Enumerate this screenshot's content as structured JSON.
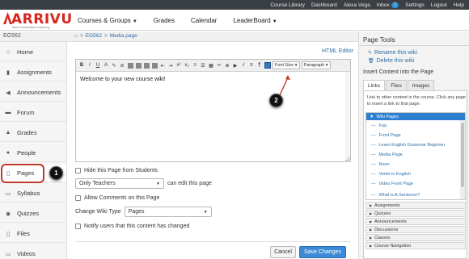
{
  "topbar": {
    "links": [
      "Course Library",
      "Dashboard",
      "Alexa Vega",
      "Inbox",
      "Settings",
      "Logout",
      "Help"
    ],
    "inbox_count": "7"
  },
  "logo": {
    "name": "ARRIVU",
    "tagline": "Next Generation Learning"
  },
  "mainnav": {
    "items": [
      {
        "label": "Courses & Groups",
        "dropdown": true
      },
      {
        "label": "Grades",
        "dropdown": false
      },
      {
        "label": "Calendar",
        "dropdown": false
      },
      {
        "label": "LeaderBoard",
        "dropdown": true
      }
    ]
  },
  "course": {
    "code": "EG562"
  },
  "breadcrumb": {
    "course": "EG562",
    "page": "Media page"
  },
  "sidebar": {
    "items": [
      {
        "label": "Home",
        "icon": "home-icon"
      },
      {
        "label": "Assignments",
        "icon": "clipboard-icon"
      },
      {
        "label": "Announcements",
        "icon": "megaphone-icon"
      },
      {
        "label": "Forum",
        "icon": "forum-icon"
      },
      {
        "label": "Grades",
        "icon": "grades-icon"
      },
      {
        "label": "People",
        "icon": "people-icon"
      },
      {
        "label": "Pages",
        "icon": "document-icon"
      },
      {
        "label": "Syllabus",
        "icon": "syllabus-icon"
      },
      {
        "label": "Quizzes",
        "icon": "quiz-icon"
      },
      {
        "label": "Files",
        "icon": "file-icon"
      },
      {
        "label": "Videos",
        "icon": "video-icon"
      }
    ],
    "active": "Pages"
  },
  "callouts": {
    "one": "1",
    "two": "2"
  },
  "editor": {
    "html_editor_link": "HTML Editor",
    "font_size_label": "Font Size",
    "paragraph_label": "Paragraph",
    "content": "Welcome to your new course wiki!"
  },
  "options": {
    "hide_label": "Hide this Page from Students",
    "editors_value": "Only Teachers",
    "can_edit_label": "can edit this page",
    "allow_comments_label": "Allow Comments on this Page",
    "wiki_type_label": "Change Wiki Type",
    "wiki_type_value": "Pages",
    "notify_label": "Notify users that this content has changed"
  },
  "buttons": {
    "cancel": "Cancel",
    "save": "Save Changes"
  },
  "page_tools": {
    "title": "Page Tools",
    "rename": "Rename this wiki",
    "delete": "Delete this wiki",
    "insert_title": "Insert Content into the Page",
    "tabs": [
      "Links",
      "Files",
      "Images"
    ],
    "active_tab": "Links",
    "description": "Link to other content in the course. Click any page to insert a link to that page.",
    "tree_header": "Wiki Pages",
    "wiki_pages": [
      "Faq",
      "Front Page",
      "Learn English Grammar Beginner",
      "Media Page",
      "Noun",
      "Verbs in English",
      "Video Front Page",
      "What is A Sentence?"
    ],
    "sections": [
      "Assignments",
      "Quizzes",
      "Announcements",
      "Discussions",
      "Classes",
      "Course Navigation"
    ]
  },
  "colors": {
    "brand": "#d9261c",
    "accent": "#3d8ad6",
    "link": "#2b6ea8",
    "highlight": "#c0392b"
  }
}
